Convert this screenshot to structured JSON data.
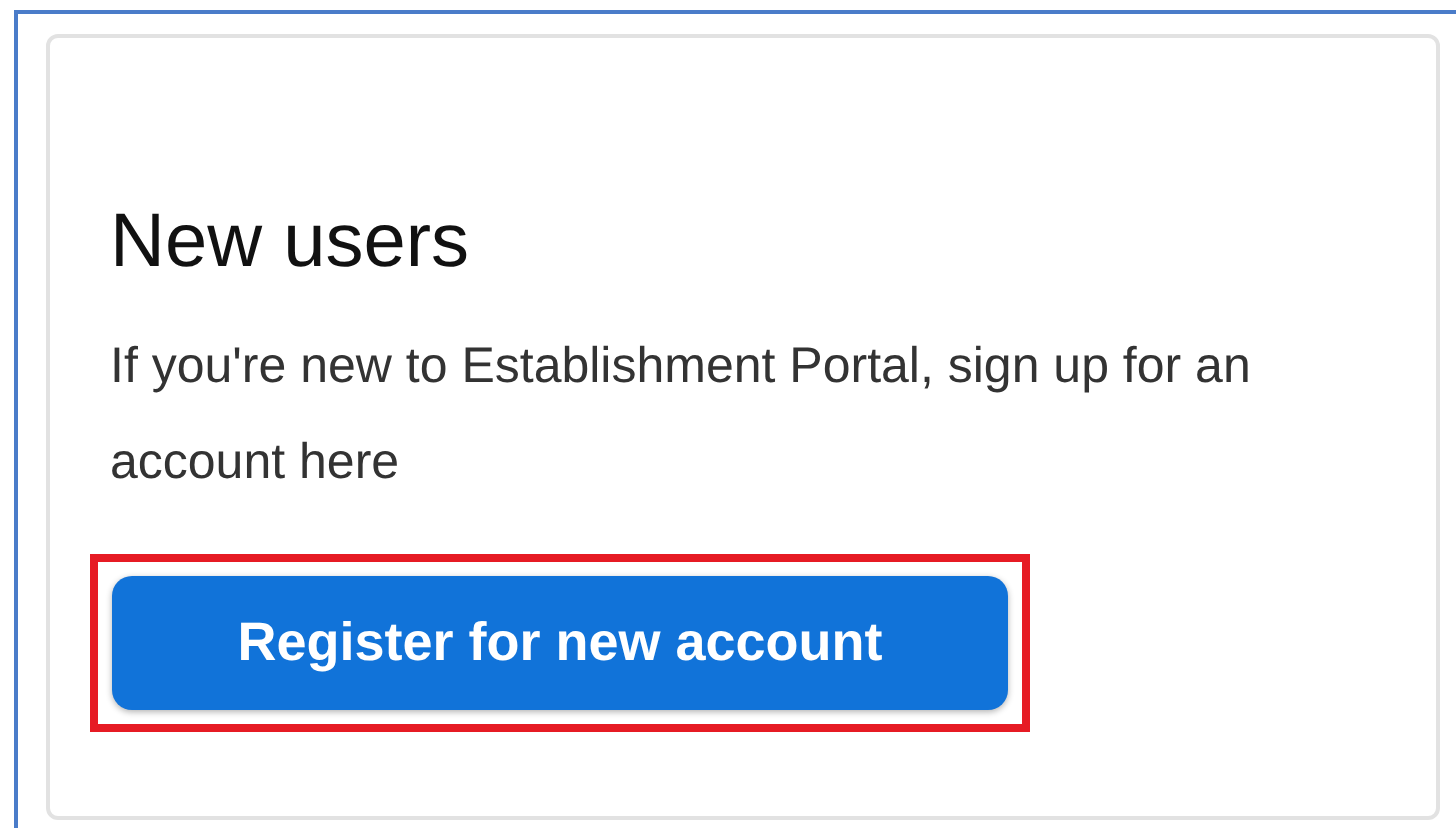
{
  "card": {
    "title": "New users",
    "text": "If you're new to Establishment Portal, sign up for an account here",
    "button": {
      "label": "Register for new account",
      "highlighted": true
    }
  }
}
